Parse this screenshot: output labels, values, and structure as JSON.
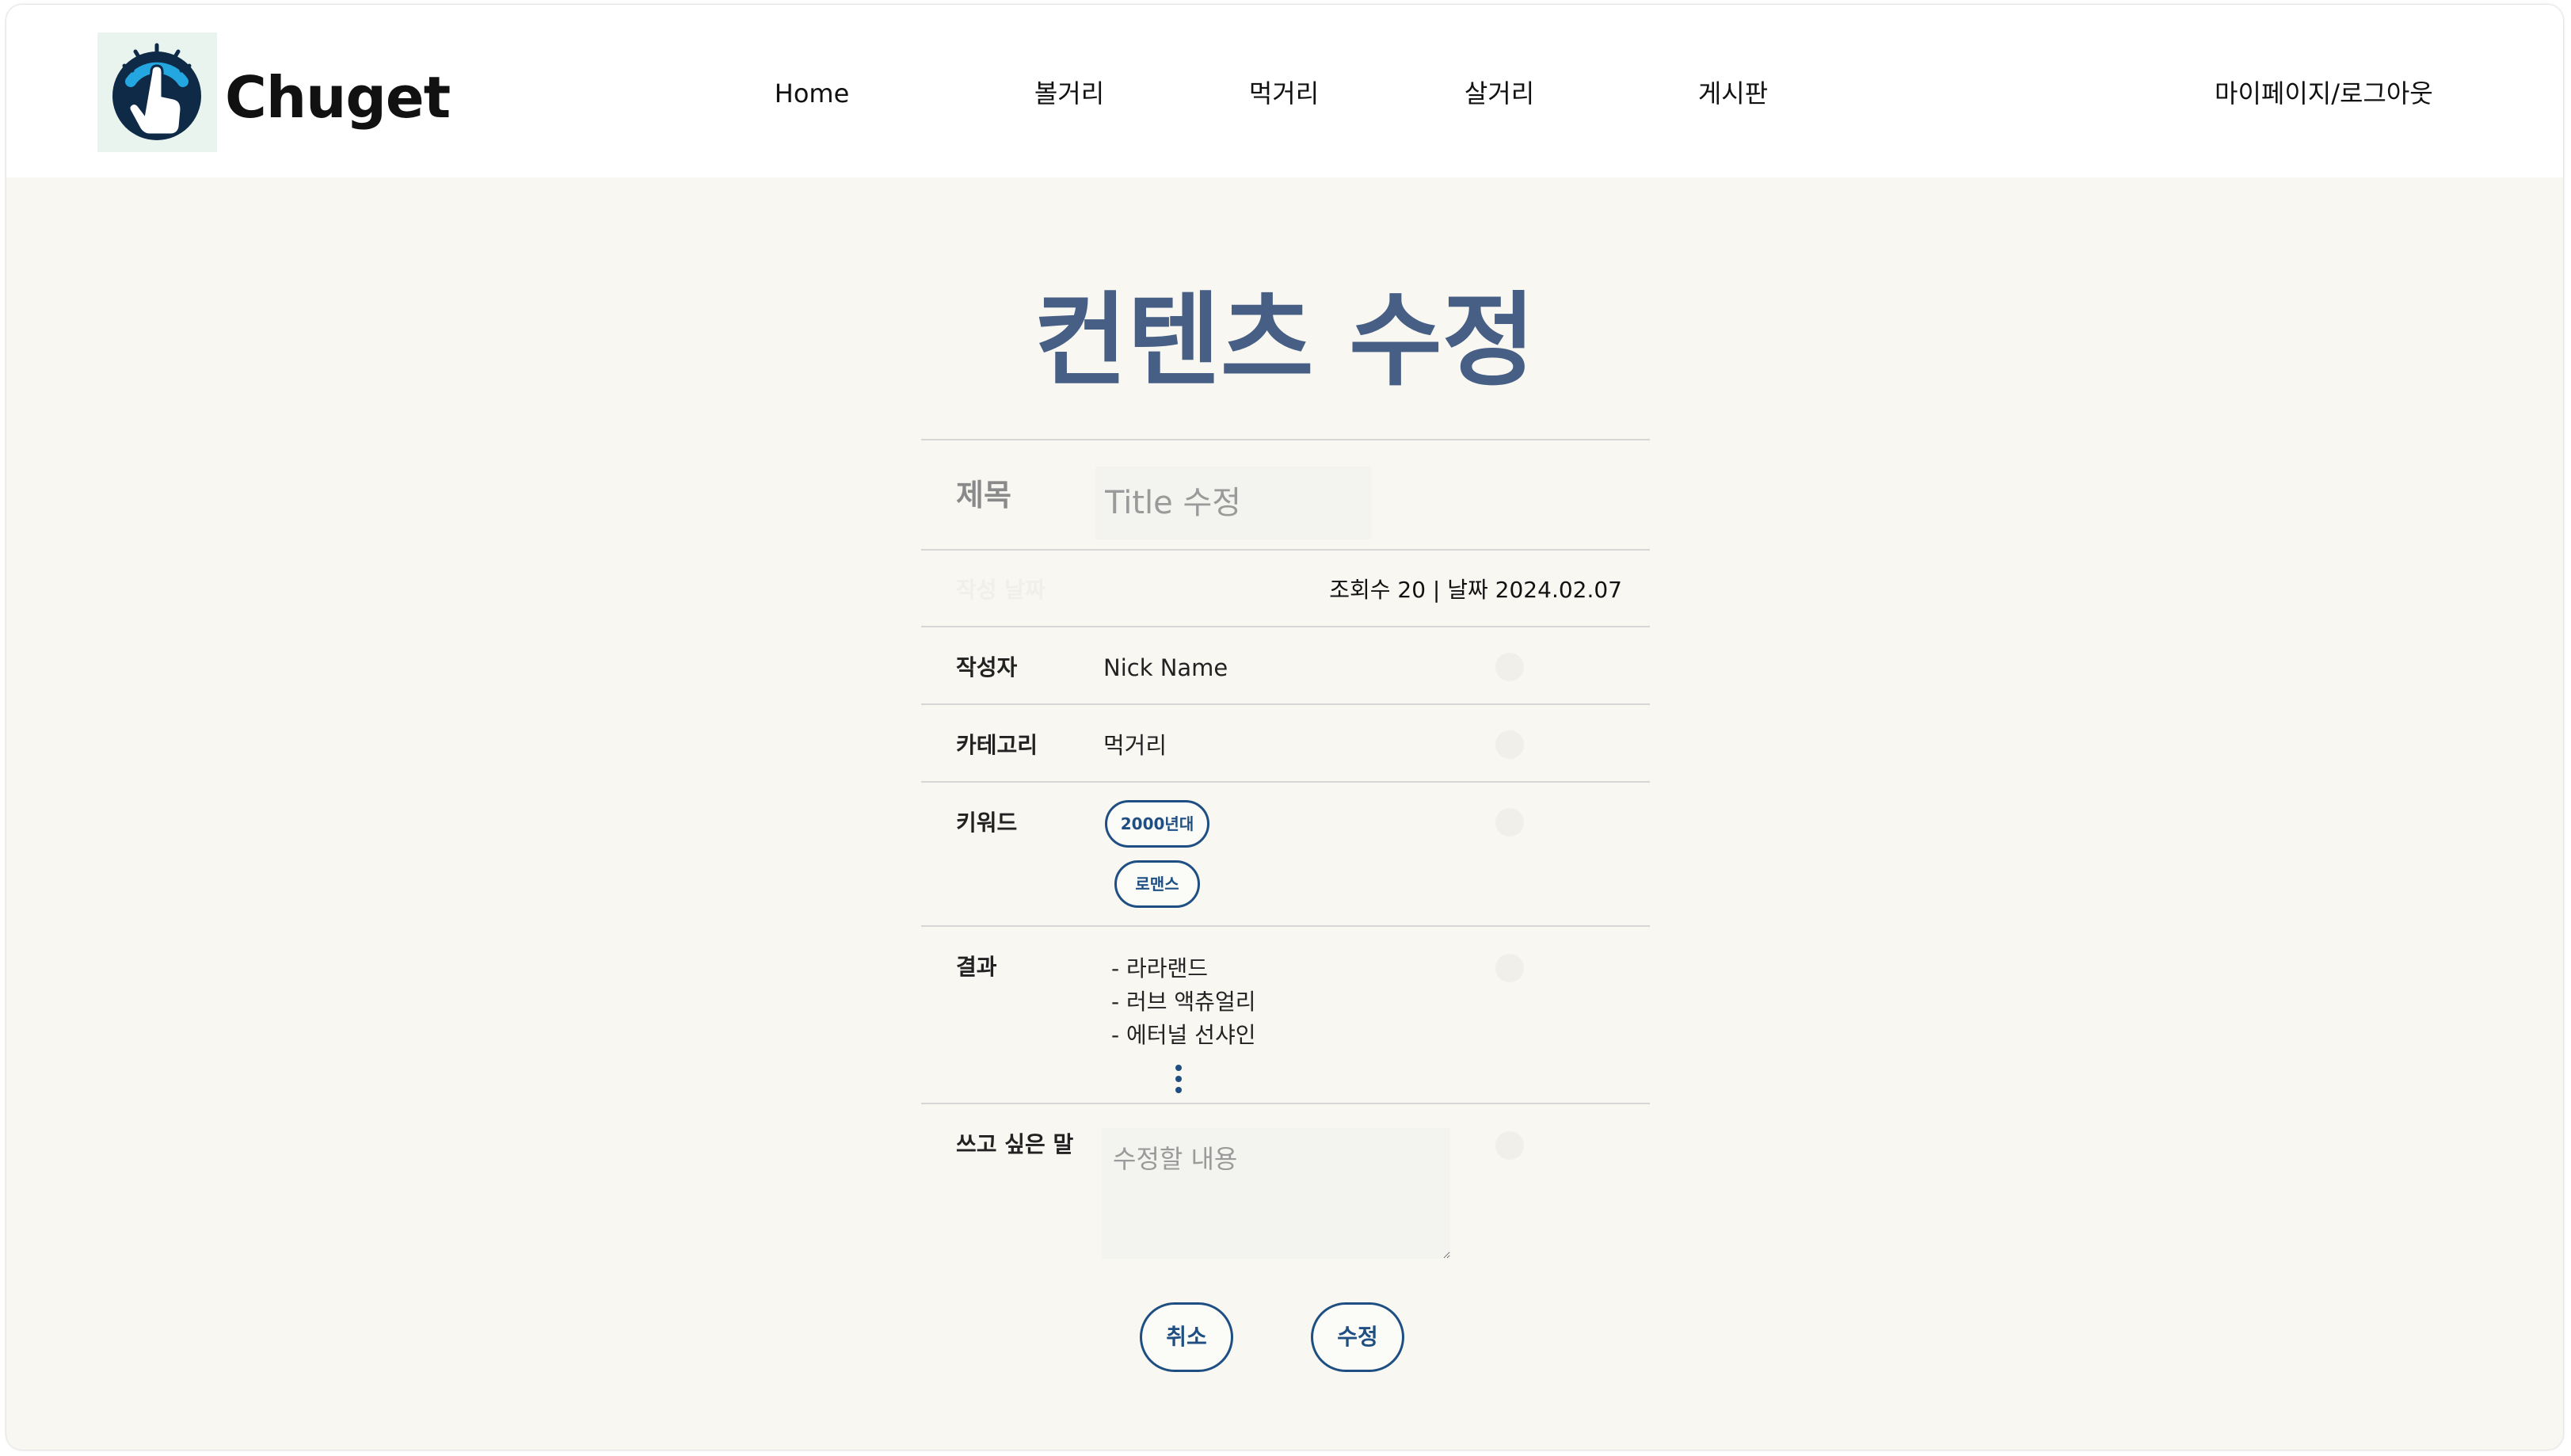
{
  "brand": {
    "name": "Chuget",
    "logo_icon": "hand-pointer-icon"
  },
  "nav": {
    "home": "Home",
    "items": [
      "볼거리",
      "먹거리",
      "살거리",
      "게시판"
    ],
    "mypage_logout": "마이페이지/로그아웃"
  },
  "page": {
    "title": "컨텐츠 수정"
  },
  "form": {
    "title_label": "제목",
    "title_placeholder": "Title 수정",
    "meta_label": "작성 날짜",
    "meta_info": "조회수 20 |  날짜  2024.02.07",
    "author_label": "작성자",
    "author_value": "Nick Name",
    "category_label": "카테고리",
    "category_value": "먹거리",
    "keyword_label": "키워드",
    "keywords": [
      "2000년대",
      "로맨스"
    ],
    "result_label": "결과",
    "results": [
      "- 라라랜드",
      "- 러브 액츄얼리",
      "- 에터널 선샤인"
    ],
    "message_label": "쓰고 싶은 말",
    "message_placeholder": "수정할 내용"
  },
  "buttons": {
    "cancel": "취소",
    "submit": "수정"
  },
  "colors": {
    "accent": "#1f4f82",
    "title": "#475f85",
    "background": "#f8f7f2"
  }
}
